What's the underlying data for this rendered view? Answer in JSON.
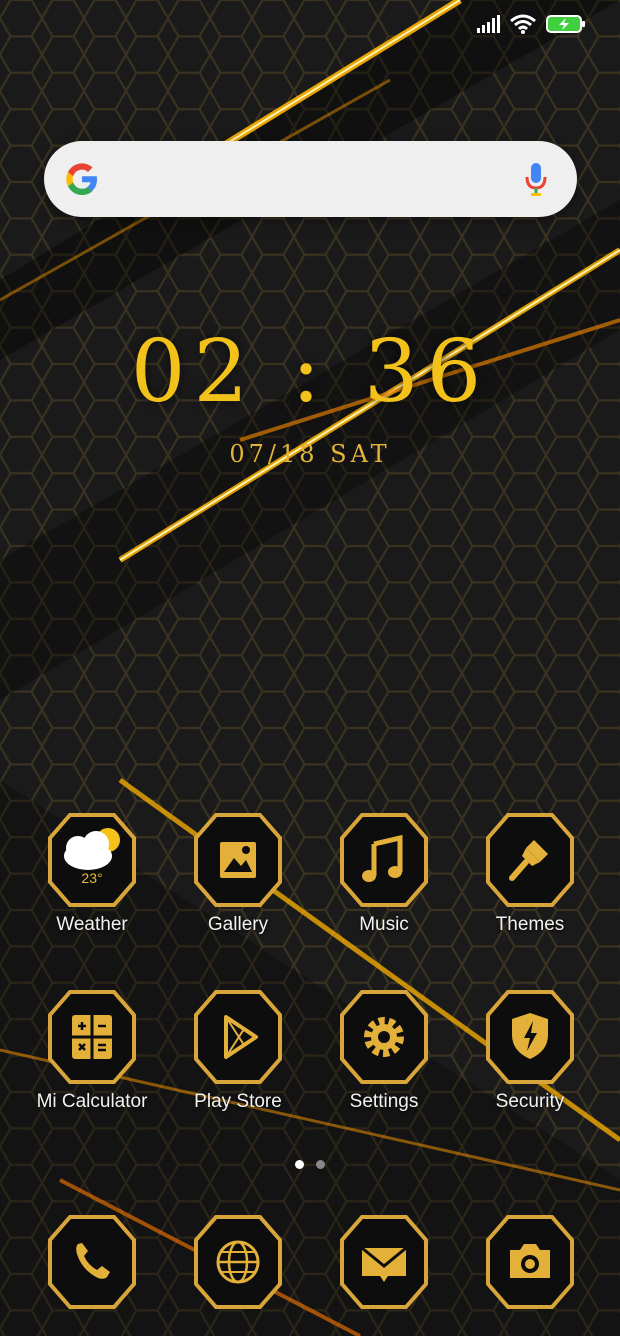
{
  "clock": {
    "time": "02 : 36",
    "date": "07/18 SAT"
  },
  "weather": {
    "temperature": "23°"
  },
  "apps": [
    {
      "label": "Weather",
      "icon": "weather-cloud-sun-icon"
    },
    {
      "label": "Gallery",
      "icon": "image-icon"
    },
    {
      "label": "Music",
      "icon": "music-note-icon"
    },
    {
      "label": "Themes",
      "icon": "paintbrush-icon"
    },
    {
      "label": "Mi Calculator",
      "icon": "calculator-icon"
    },
    {
      "label": "Play Store",
      "icon": "play-icon"
    },
    {
      "label": "Settings",
      "icon": "gear-icon"
    },
    {
      "label": "Security",
      "icon": "shield-bolt-icon"
    }
  ],
  "dock": [
    {
      "icon": "phone-icon"
    },
    {
      "icon": "browser-globe-icon"
    },
    {
      "icon": "mail-icon"
    },
    {
      "icon": "camera-icon"
    }
  ],
  "pager": {
    "pages": 2,
    "active": 1
  },
  "colors": {
    "gold": "#f2c21b",
    "background": "#141414"
  }
}
